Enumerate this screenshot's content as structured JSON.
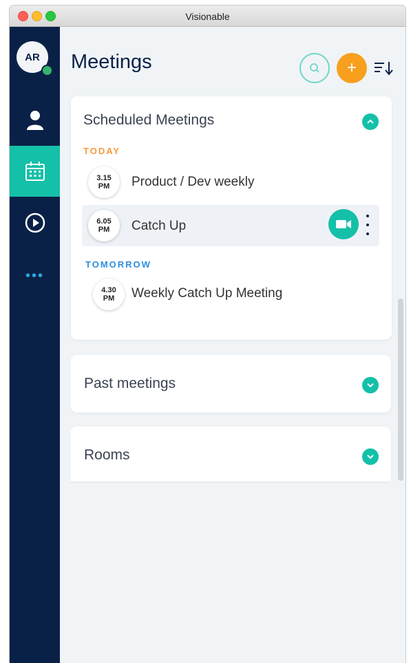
{
  "window": {
    "title": "Visionable"
  },
  "sidebar": {
    "avatar_initials": "AR",
    "items": [
      {
        "name": "contacts",
        "icon": "person-icon"
      },
      {
        "name": "meetings",
        "icon": "calendar-icon",
        "active": true
      },
      {
        "name": "recordings",
        "icon": "play-circle-icon"
      },
      {
        "name": "more",
        "icon": "more-dots-icon"
      }
    ]
  },
  "header": {
    "title": "Meetings",
    "search_icon": "search-icon",
    "add_label": "+",
    "sort_icon": "sort-icon"
  },
  "scheduled": {
    "title": "Scheduled Meetings",
    "today_label": "TODAY",
    "tomorrow_label": "TOMORROW",
    "meetings": [
      {
        "time": "3.15",
        "ampm": "PM",
        "title": "Product / Dev weekly"
      },
      {
        "time": "6.05",
        "ampm": "PM",
        "title": "Catch Up"
      },
      {
        "time": "4.30",
        "ampm": "PM",
        "title": "Weekly Catch Up Meeting"
      }
    ]
  },
  "past": {
    "title": "Past meetings"
  },
  "rooms": {
    "title": "Rooms"
  },
  "colors": {
    "navy": "#0a2147",
    "teal": "#14c0a8",
    "orange": "#f8a01e",
    "today": "#f79a3e",
    "tomorrow": "#2b8fe0"
  }
}
